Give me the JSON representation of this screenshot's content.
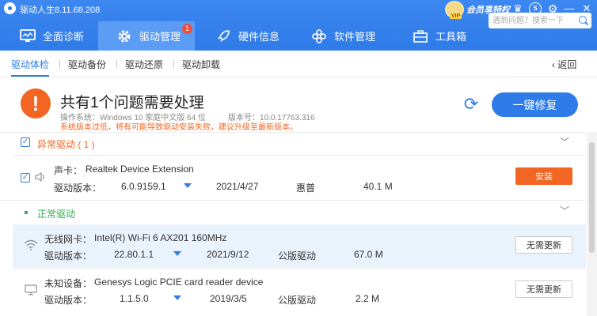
{
  "app": {
    "title": "驱动人生8.11.68.208",
    "member_label": "会员享特权",
    "vip_label": "VIP"
  },
  "nav": {
    "items": [
      {
        "label": "全面诊断",
        "icon": "monitor-icon"
      },
      {
        "label": "驱动管理",
        "icon": "gear-icon",
        "badge": "1"
      },
      {
        "label": "硬件信息",
        "icon": "rocket-icon"
      },
      {
        "label": "软件管理",
        "icon": "apps-icon"
      },
      {
        "label": "工具箱",
        "icon": "toolbox-icon"
      }
    ],
    "search_placeholder": "遇到问题？搜索一下"
  },
  "subtabs": {
    "items": [
      "驱动体检",
      "驱动备份",
      "驱动还原",
      "驱动卸载"
    ],
    "back_label": "返回"
  },
  "header": {
    "title": "共有1个问题需要处理",
    "system": "操作系统：Windows 10 家庭中文版 64 位",
    "version": "版本号：10.0.17763.316",
    "warning": "系统版本过低，将有可能导致驱动安装失败，建议升级至最新版本。",
    "fix_label": "一键修复"
  },
  "abnormal": {
    "title": "异常驱动 ( 1 )",
    "rows": [
      {
        "type": "声卡：",
        "name": "Realtek Device Extension",
        "version_label": "驱动版本：",
        "version": "6.0.9159.1",
        "date": "2021/4/27",
        "vendor": "惠普",
        "size": "40.1 M",
        "action": "安装"
      }
    ]
  },
  "normal": {
    "title": "正常驱动",
    "rows": [
      {
        "type": "无线网卡：",
        "name": "Intel(R) Wi-Fi 6 AX201 160MHz",
        "version_label": "驱动版本：",
        "version": "22.80.1.1",
        "date": "2021/9/12",
        "vendor": "公版驱动",
        "size": "67.0 M",
        "action": "无需更新"
      },
      {
        "type": "未知设备：",
        "name": "Genesys Logic PCIE card reader device",
        "version_label": "驱动版本：",
        "version": "1.1.5.0",
        "date": "2019/3/5",
        "vendor": "公版驱动",
        "size": "2.2 M",
        "action": "无需更新"
      }
    ]
  },
  "colors": {
    "primary": "#2f7be8",
    "warning": "#f26522",
    "ok": "#2bb24c"
  }
}
